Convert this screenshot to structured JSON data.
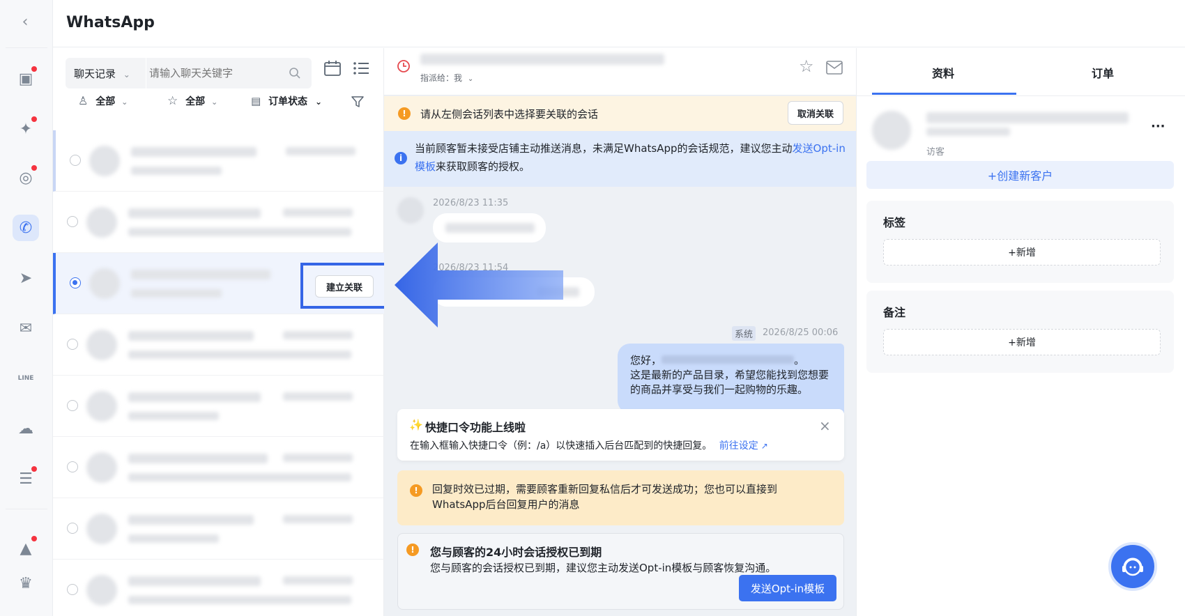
{
  "app": {
    "title": "WhatsApp"
  },
  "rail": {
    "items": [
      {
        "name": "shop-icon",
        "glyph": "▣",
        "badge": true
      },
      {
        "name": "messenger-icon",
        "glyph": "✦",
        "badge": true
      },
      {
        "name": "instagram-icon",
        "glyph": "◎",
        "badge": true
      },
      {
        "name": "whatsapp-icon",
        "glyph": "✆",
        "badge": false,
        "active": true
      },
      {
        "name": "telegram-icon",
        "glyph": "➤",
        "badge": false
      },
      {
        "name": "email-icon",
        "glyph": "✉",
        "badge": false
      },
      {
        "name": "line-icon",
        "glyph": "LINE",
        "badge": false
      },
      {
        "name": "wechat-icon",
        "glyph": "☁",
        "badge": false
      },
      {
        "name": "chat-icon",
        "glyph": "☰",
        "badge": true
      },
      {
        "name": "image-icon",
        "glyph": "▲",
        "badge": true
      },
      {
        "name": "crown-icon",
        "glyph": "♛",
        "badge": false
      }
    ]
  },
  "list": {
    "filter_select": "聊天记录",
    "search_placeholder": "请输入聊天关键字",
    "filter_agent": "全部",
    "filter_star": "全部",
    "filter_order": "订单状态",
    "link_button": "建立关联"
  },
  "chat": {
    "assigned_label": "指派给：",
    "assigned_value": "我",
    "link_notice": "请从左侧会话列表中选择要关联的会话",
    "cancel_link": "取消关联",
    "info_text_before": "当前顾客暂未接受店铺主动推送消息，未满足WhatsApp的会话规范，建议您主动",
    "info_link": "发送Opt-in模板",
    "info_text_after": "来获取顾客的授权。",
    "msg1_time": "2026/8/23 11:35",
    "msg2_time": "2026/8/23 11:54",
    "sys_tag": "系统",
    "msg3_time": "2026/8/25 00:06",
    "msg3_greeting": "您好，",
    "msg3_greeting_end": "。",
    "msg3_body": "这是最新的产品目录，希望您能找到您想要的商品并享受与我们一起购物的乐趣。",
    "quick_title": "快捷口令功能上线啦",
    "quick_body": "在输入框输入快捷口令（例：/a）以快速插入后台匹配到的快捷回复。",
    "quick_link": "前往设定",
    "expired_text": "回复时效已过期，需要顾客重新回复私信后才可发送成功；您也可以直接到WhatsApp后台回复用户的消息",
    "auth_title": "您与顾客的24小时会话授权已到期",
    "auth_body": "您与顾客的会话授权已到期，建议您主动发送Opt-in模板与顾客恢复沟通。",
    "auth_button": "发送Opt-in模板"
  },
  "right": {
    "tab_profile": "资料",
    "tab_orders": "订单",
    "visitor_label": "访客",
    "create_customer": "+创建新客户",
    "tags_title": "标签",
    "tags_add": "+新增",
    "notes_title": "备注",
    "notes_add": "+新增",
    "more": "···"
  },
  "colors": {
    "accent": "#3b72f0",
    "warn": "#f59a23",
    "arrow": "#4a7ef0"
  }
}
